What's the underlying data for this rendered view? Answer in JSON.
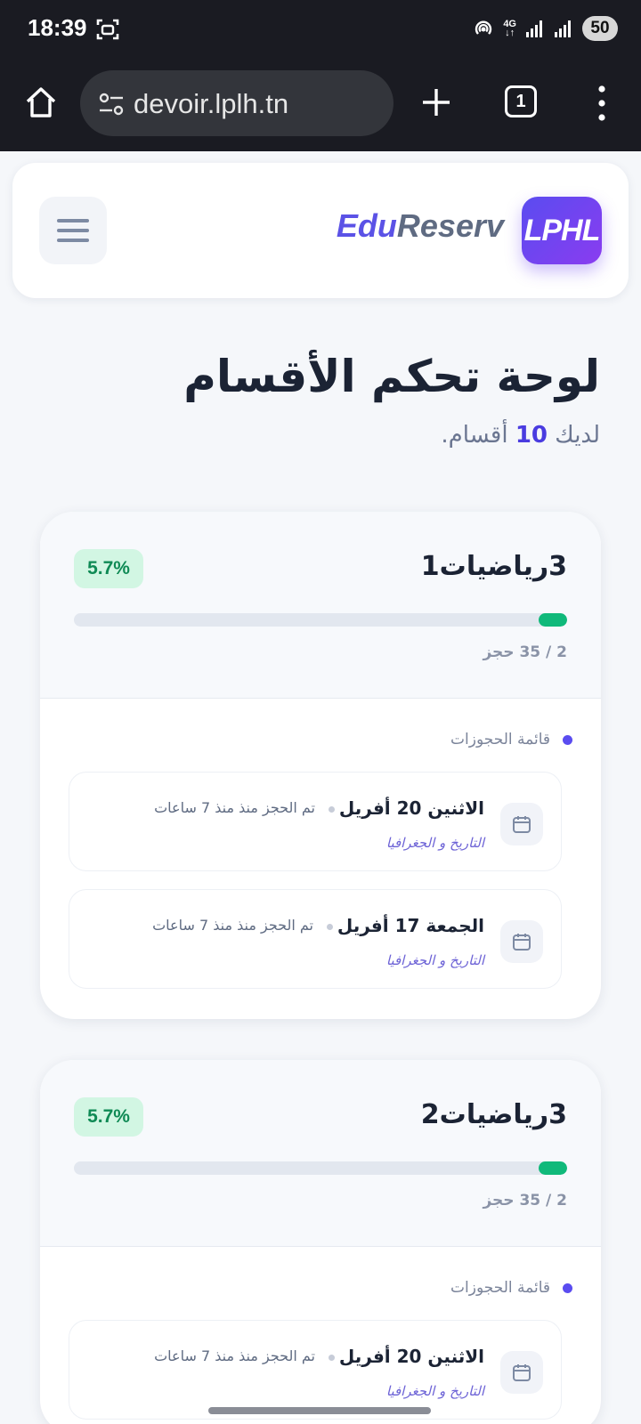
{
  "status_bar": {
    "time": "18:39",
    "network": "4G",
    "battery": "50"
  },
  "browser": {
    "url": "devoir.lplh.tn",
    "tab_count": "1"
  },
  "header": {
    "brand_edu": "Edu",
    "brand_reserv": "Reserv",
    "logo_text": "LPHL"
  },
  "page": {
    "title": "لوحة تحكم الأقسام",
    "subtitle_prefix": "لديك",
    "section_count": "10",
    "subtitle_suffix": "أقسام."
  },
  "sections": [
    {
      "name": "3رياضيات1",
      "percent_label": "5.7%",
      "progress": 0.057,
      "booking_count": "2 / 35 حجز",
      "list_title": "قائمة الحجوزات",
      "bookings": [
        {
          "date": "الاثنين 20 أفريل",
          "ago": "تم الحجز منذ منذ 7 ساعات",
          "subject": "التاريخ و الجغرافيا"
        },
        {
          "date": "الجمعة 17 أفريل",
          "ago": "تم الحجز منذ منذ 7 ساعات",
          "subject": "التاريخ و الجغرافيا"
        }
      ]
    },
    {
      "name": "3رياضيات2",
      "percent_label": "5.7%",
      "progress": 0.057,
      "booking_count": "2 / 35 حجز",
      "list_title": "قائمة الحجوزات",
      "bookings": [
        {
          "date": "الاثنين 20 أفريل",
          "ago": "تم الحجز منذ منذ 7 ساعات",
          "subject": "التاريخ و الجغرافيا"
        }
      ]
    }
  ],
  "colors": {
    "accent": "#5a4cf0",
    "success": "#10b97a",
    "badge_bg": "#d2f6e3"
  }
}
